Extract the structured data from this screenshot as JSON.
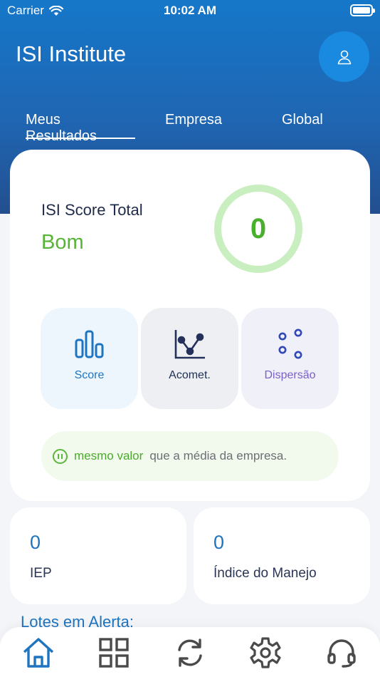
{
  "status_bar": {
    "carrier": "Carrier",
    "time": "10:02 AM"
  },
  "header": {
    "title": "ISI Institute",
    "avatar_icon": "user-icon"
  },
  "tabs": [
    {
      "label": "Meus Resultados",
      "active": true
    },
    {
      "label": "Empresa",
      "active": false
    },
    {
      "label": "Global",
      "active": false
    }
  ],
  "score_card": {
    "label": "ISI Score Total",
    "level": "Bom",
    "value": "0",
    "metrics": [
      {
        "label": "Score",
        "icon": "bar-chart-icon"
      },
      {
        "label": "Acomet.",
        "icon": "line-chart-icon"
      },
      {
        "label": "Dispersão",
        "icon": "scatter-icon"
      }
    ],
    "comparison": {
      "highlight": "mesmo valor",
      "text": "que a média da empresa.",
      "icon": "pause-circle-icon"
    }
  },
  "stats": [
    {
      "value": "0",
      "label": "IEP"
    },
    {
      "value": "0",
      "label": "Índice do Manejo"
    }
  ],
  "alerts_title": "Lotes em Alerta:",
  "tab_bar": [
    {
      "icon": "home-icon",
      "active": true
    },
    {
      "icon": "grid-icon",
      "active": false
    },
    {
      "icon": "sync-icon",
      "active": false
    },
    {
      "icon": "settings-icon",
      "active": false
    },
    {
      "icon": "headset-icon",
      "active": false
    }
  ],
  "colors": {
    "header_top": "#1577c9",
    "header_bottom": "#234f8f",
    "accent_blue": "#1f74c0",
    "good_green": "#49b02d",
    "ring_green": "#c9eec0"
  }
}
